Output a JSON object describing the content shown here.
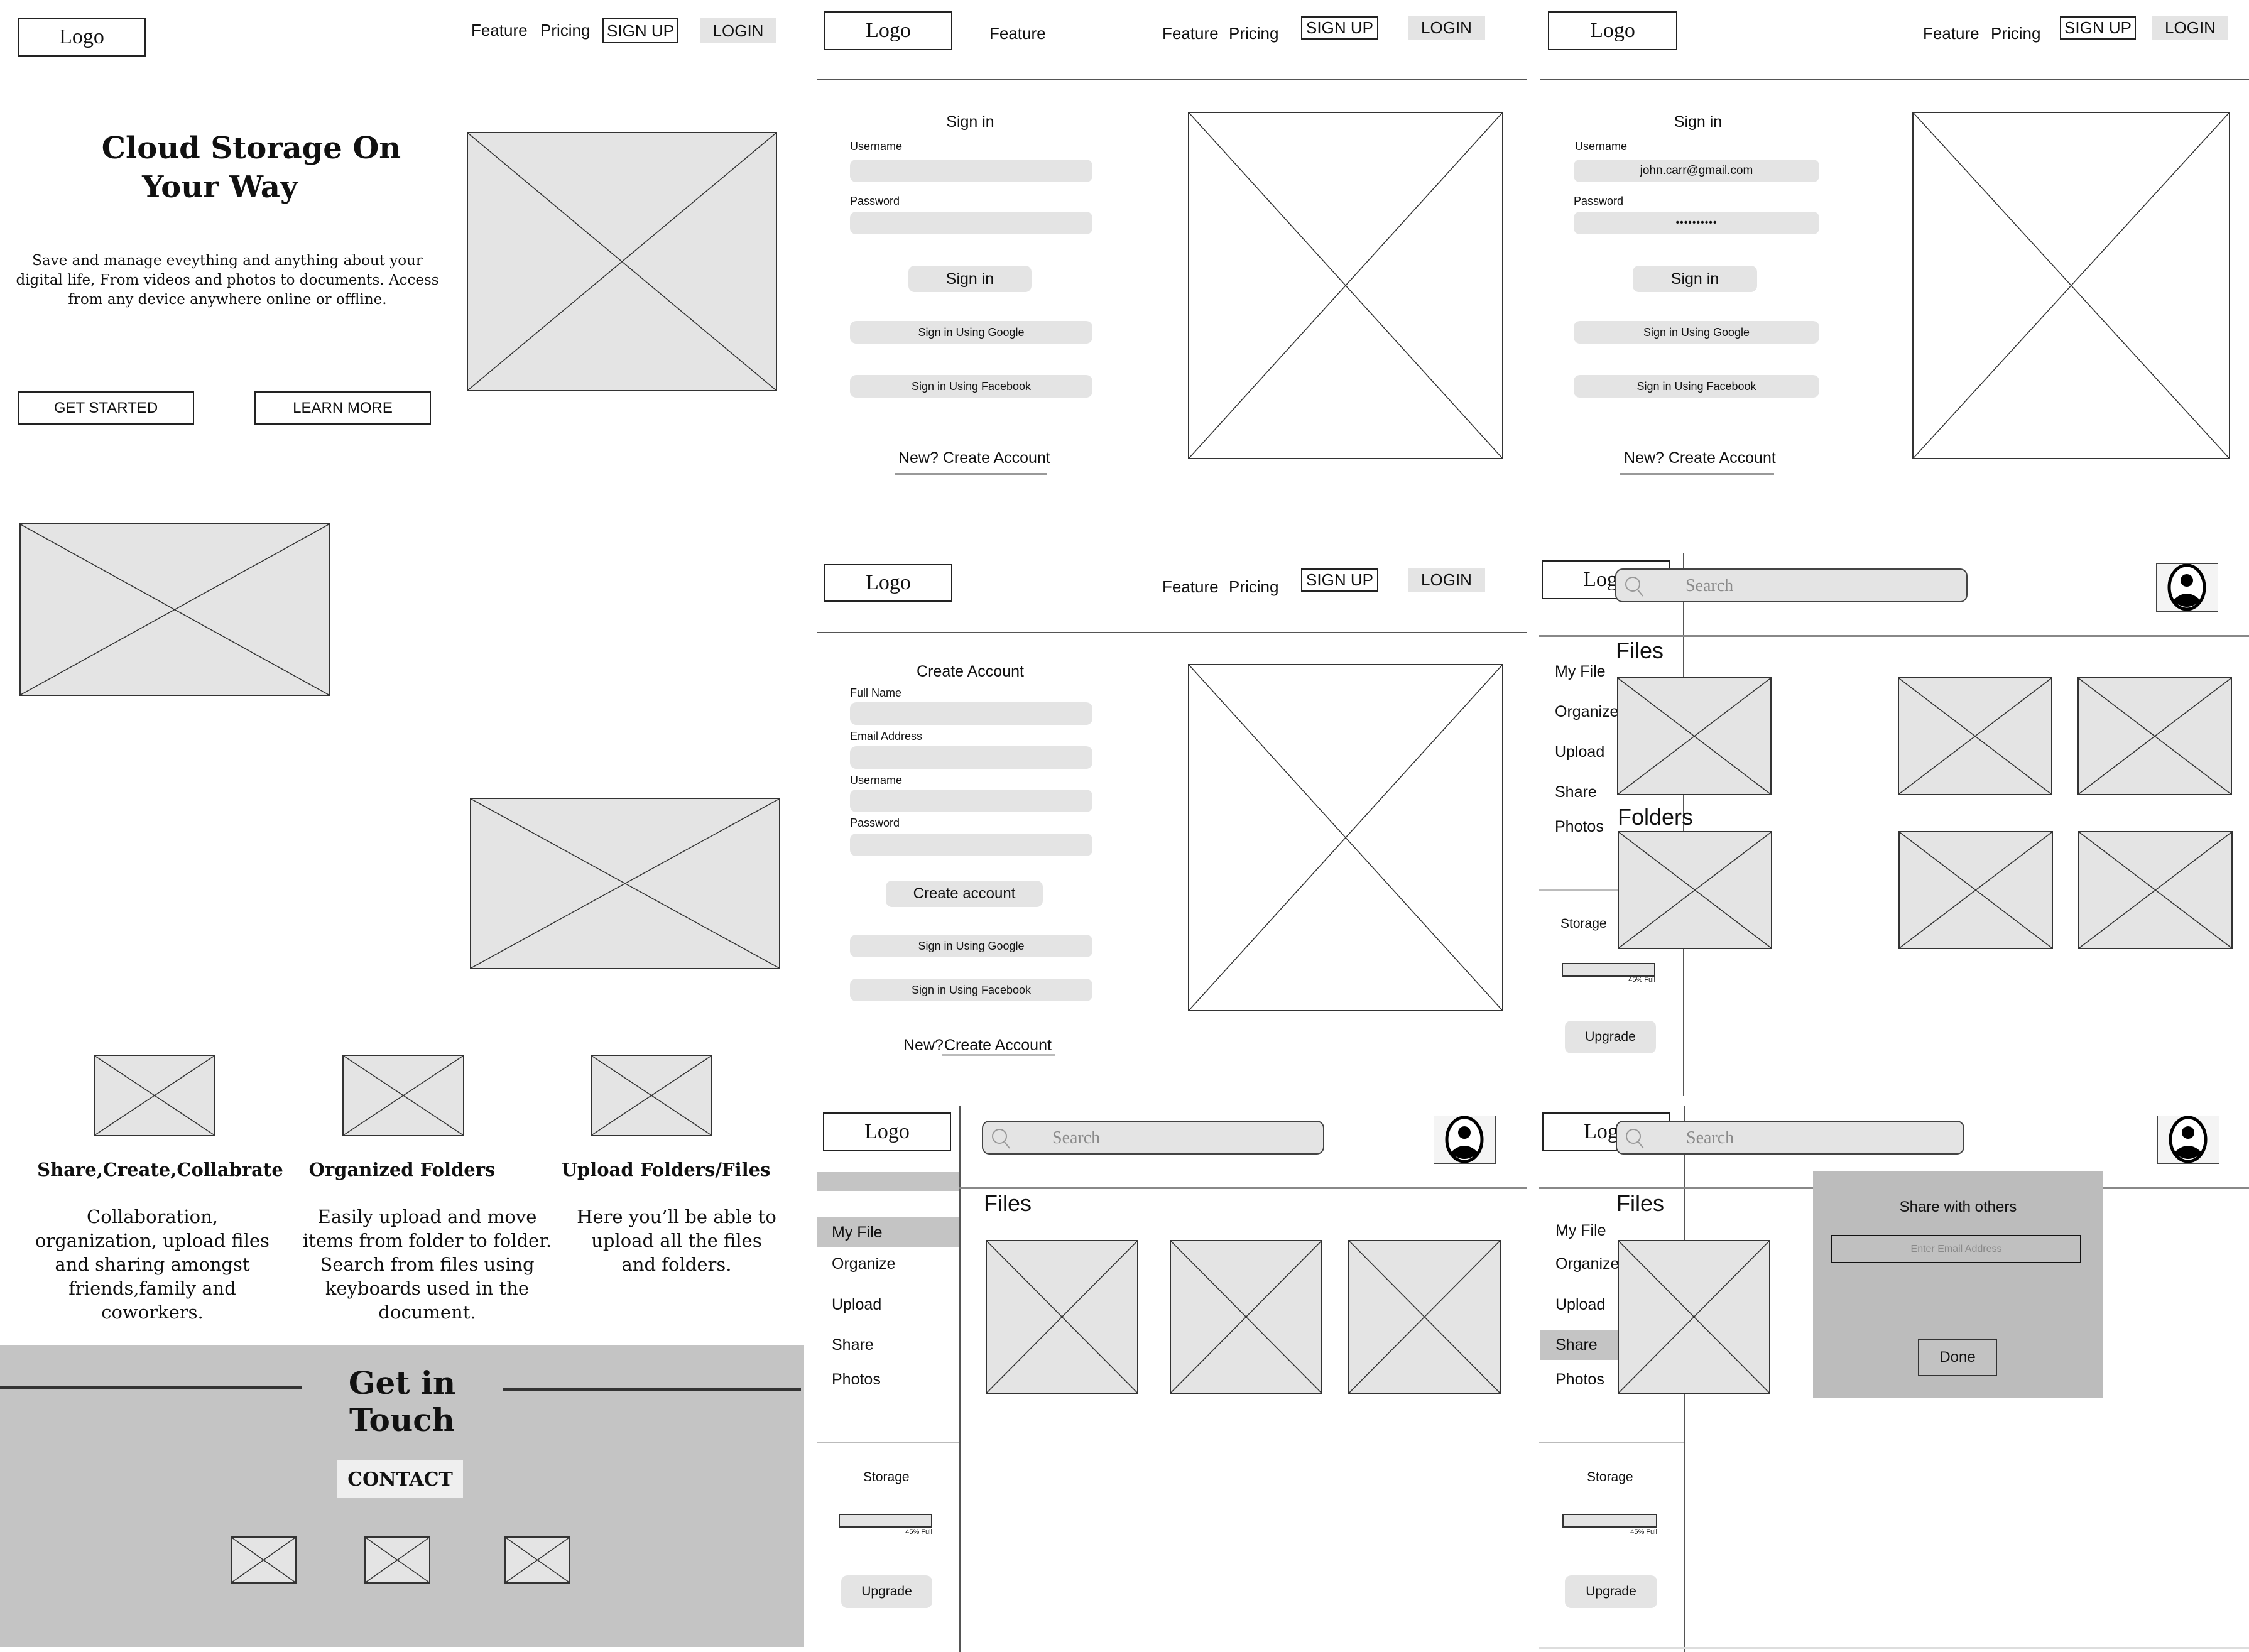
{
  "landing": {
    "logo": "Logo",
    "nav": {
      "feature": "Feature",
      "pricing": "Pricing",
      "signup": "SIGN UP",
      "login": "LOGIN"
    },
    "hero_title_line1": "Cloud Storage On",
    "hero_title_line2": "Your Way",
    "hero_text": "Save and manage eveything and anything about your digital life, From videos and photos to documents. Access from any device anywhere online or offline.",
    "get_started": "GET STARTED",
    "learn_more": "LEARN MORE",
    "features": [
      {
        "title": "Share,Create,Collabrate",
        "text": "Collaboration, organization, upload files and sharing amongst friends,family and coworkers."
      },
      {
        "title": "Organized Folders",
        "text": "Easily upload and move items from folder to folder. Search from files using keyboards used in the document."
      },
      {
        "title": "Upload Folders/Files",
        "text": "Here you’ll be able to upload all the files and folders."
      }
    ],
    "contact_heading": "Get in Touch",
    "contact_button": "CONTACT"
  },
  "signin_empty": {
    "logo": "Logo",
    "nav": {
      "feature": "Feature",
      "pricing": "Pricing",
      "signup": "SIGN UP",
      "login": "LOGIN"
    },
    "title": "Sign in",
    "username_label": "Username",
    "username_value": "",
    "password_label": "Password",
    "password_value": "",
    "signin_button": "Sign in",
    "google_button": "Sign in Using Google",
    "facebook_button": "Sign in Using Facebook",
    "create_link": "New? Create Account"
  },
  "signin_filled": {
    "logo": "Logo",
    "nav": {
      "feature": "Feature",
      "pricing": "Pricing",
      "signup": "SIGN UP",
      "login": "LOGIN"
    },
    "title": "Sign in",
    "username_label": "Username",
    "username_value": "john.carr@gmail.com",
    "password_label": "Password",
    "password_value": "••••••••••",
    "signin_button": "Sign in",
    "google_button": "Sign in Using Google",
    "facebook_button": "Sign in Using Facebook",
    "create_link": "New? Create Account"
  },
  "create_account": {
    "logo": "Logo",
    "nav": {
      "feature": "Feature",
      "pricing": "Pricing",
      "signup": "SIGN UP",
      "login": "LOGIN"
    },
    "title": "Create Account",
    "fullname_label": "Full Name",
    "email_label": "Email Address",
    "username_label": "Username",
    "password_label": "Password",
    "create_button": "Create account",
    "google_button": "Sign in Using Google",
    "facebook_button": "Sign in Using Facebook",
    "new_prefix": "New?",
    "create_link": "Create Account"
  },
  "dashboard_main": {
    "logo": "Logo",
    "search_placeholder": "Search",
    "sidebar": [
      "My File",
      "Organize",
      "Upload",
      "Share",
      "Photos"
    ],
    "files_heading": "Files",
    "folders_heading": "Folders",
    "storage_label": "Storage",
    "storage_percent": 45,
    "storage_text": "45% Full",
    "upgrade": "Upgrade"
  },
  "dashboard_myfile": {
    "logo": "Logo",
    "search_placeholder": "Search",
    "sidebar": [
      "My File",
      "Organize",
      "Upload",
      "Share",
      "Photos"
    ],
    "active_item": "My File",
    "files_heading": "Files",
    "storage_label": "Storage",
    "storage_percent": 45,
    "storage_text": "45% Full",
    "upgrade": "Upgrade"
  },
  "dashboard_share": {
    "logo": "Logo",
    "search_placeholder": "Search",
    "sidebar": [
      "My File",
      "Organize",
      "Upload",
      "Share",
      "Photos"
    ],
    "active_item": "Share",
    "files_heading": "Files",
    "storage_label": "Storage",
    "storage_percent": 45,
    "storage_text": "45% Full",
    "upgrade": "Upgrade",
    "modal": {
      "title": "Share with others",
      "email_placeholder": "Enter Email Address",
      "done": "Done"
    }
  },
  "colors": {
    "placeholder_fill": "#e4e4e4",
    "active_nav": "#c4c4c4",
    "footer_bg": "#c4c4c4",
    "modal_bg": "#bcbcbc"
  }
}
